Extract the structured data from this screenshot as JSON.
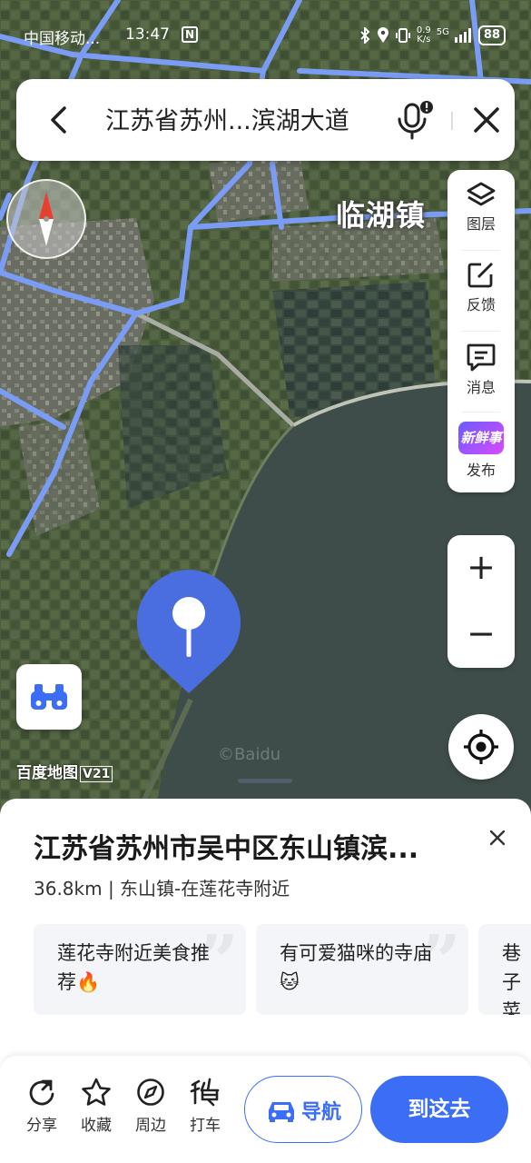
{
  "status_bar": {
    "carrier": "中国移动...",
    "time": "13:47",
    "n_icon": "N",
    "net_speed_value": "0.9",
    "net_speed_unit": "K/s",
    "signal_type": "5G",
    "battery": "88"
  },
  "search": {
    "query": "江苏省苏州...滨湖大道"
  },
  "map": {
    "town_label": "临湖镇",
    "logo_text": "百度地图",
    "logo_version": "V21",
    "watermark": "©Baidu"
  },
  "side_tools": [
    {
      "icon": "layers-icon",
      "label": "图层"
    },
    {
      "icon": "feedback-icon",
      "label": "反馈"
    },
    {
      "icon": "message-icon",
      "label": "消息"
    },
    {
      "icon": "xinxianshi-icon",
      "label": "发布",
      "badge_text": "新鲜事"
    }
  ],
  "zoom": {
    "plus": "+",
    "minus": "−"
  },
  "place": {
    "title": "江苏省苏州市吴中区东山镇滨...",
    "subtitle": "36.8km | 东山镇-在莲花寺附近"
  },
  "cards": [
    {
      "text": "莲花寺附近美食推荐🔥"
    },
    {
      "text": "有可爱猫咪的寺庙🐱"
    },
    {
      "text": "巷子菜"
    }
  ],
  "actions": [
    {
      "icon": "share-icon",
      "label": "分享"
    },
    {
      "icon": "star-icon",
      "label": "收藏"
    },
    {
      "icon": "compass-icon",
      "label": "周边"
    },
    {
      "icon": "taxi-icon",
      "label": "打车"
    }
  ],
  "buttons": {
    "navigate": "导航",
    "go_here": "到这去"
  },
  "colors": {
    "accent": "#3b6ef5",
    "road": "#7a9cf5",
    "lake": "#3f4d4a"
  }
}
